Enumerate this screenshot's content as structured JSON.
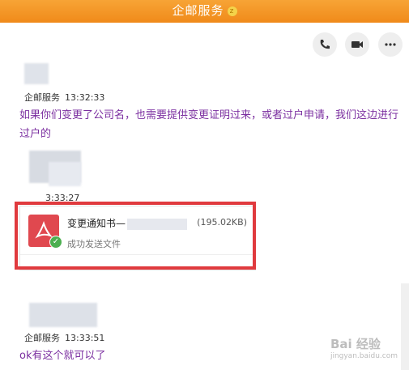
{
  "window": {
    "title": "企邮服务"
  },
  "toolbar": {
    "actions": [
      "phone-call",
      "video-call",
      "more"
    ]
  },
  "messages": [
    {
      "sender": "企邮服务",
      "time": "13:32:33",
      "text": "如果你们变更了公司名，也需要提供变更证明过来，或者过户申请，我们这边进行过户的"
    },
    {
      "time": "3:33:27"
    },
    {
      "sender": "企邮服务",
      "time": "13:33:51",
      "text": "ok有这个就可以了"
    }
  ],
  "file_card": {
    "name": "变更通知书—",
    "size": "(195.02KB)",
    "status": "成功发送文件"
  },
  "watermark": {
    "brand": "Bai 经验",
    "site": "jingyan.baidu.com"
  },
  "colors": {
    "title_bar": "#f08a1a",
    "message_text": "#7b2fa0",
    "highlight": "#e03a3e",
    "link": "#5c7ec1"
  }
}
